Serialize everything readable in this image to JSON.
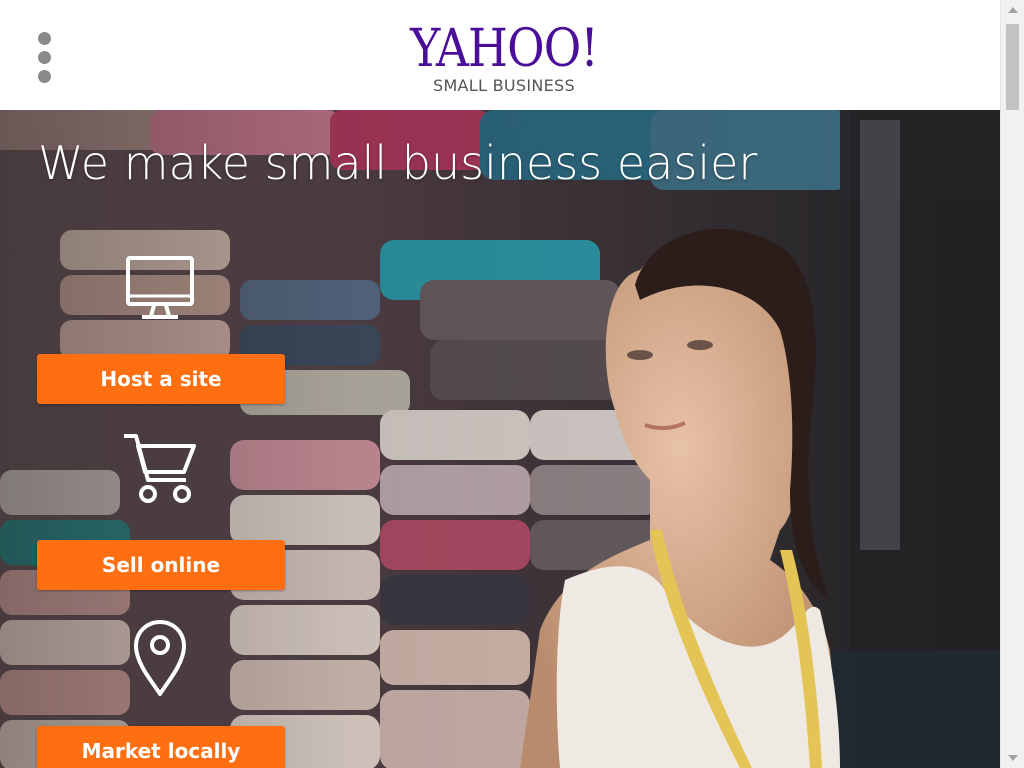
{
  "header": {
    "logo_main": "YAHOO!",
    "logo_sub": "SMALL BUSINESS",
    "menu_icon": "vertical-ellipsis-icon",
    "brand_color": "#4b0e99"
  },
  "hero": {
    "title": "We make small business easier",
    "features": [
      {
        "icon": "monitor-icon",
        "label": "Host a site"
      },
      {
        "icon": "shopping-cart-icon",
        "label": "Sell online"
      },
      {
        "icon": "map-pin-icon",
        "label": "Market locally"
      }
    ],
    "button_color": "#ff6f12"
  }
}
